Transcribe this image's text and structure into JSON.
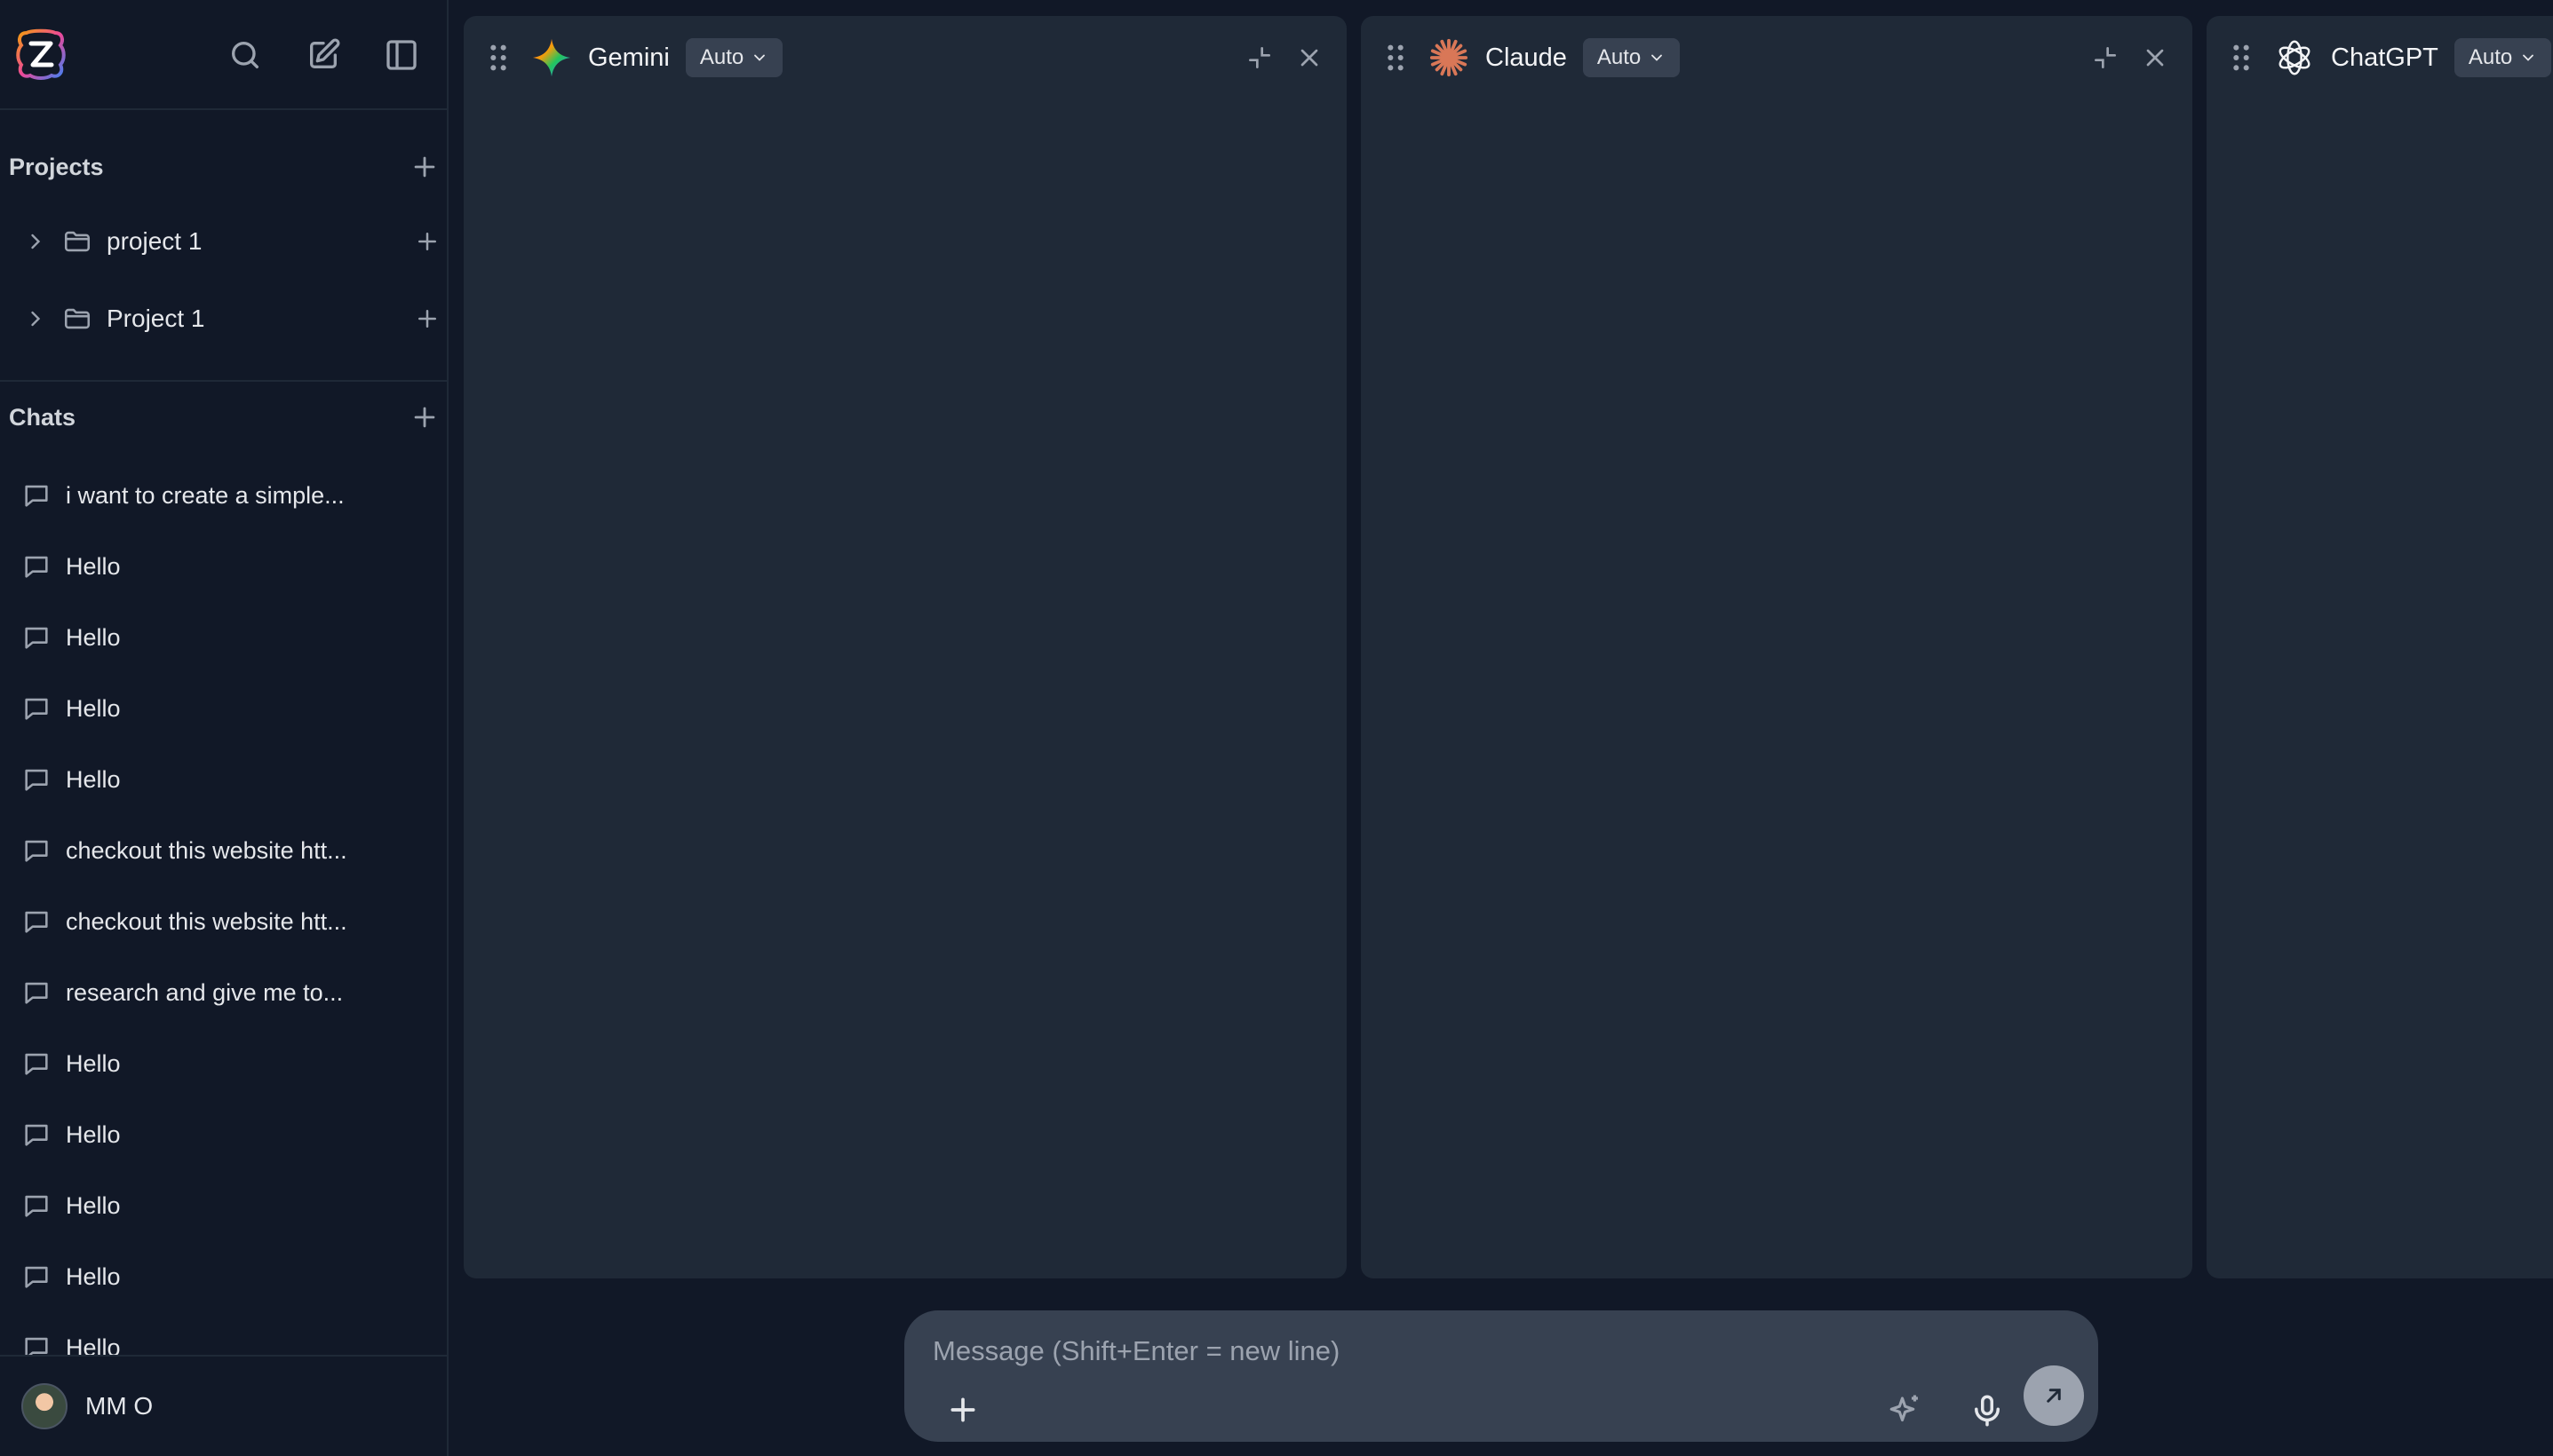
{
  "sidebar": {
    "projects_title": "Projects",
    "projects": [
      {
        "label": "project 1"
      },
      {
        "label": "Project 1"
      }
    ],
    "chats_title": "Chats",
    "chats": [
      {
        "label": "i want to create a simple..."
      },
      {
        "label": "Hello"
      },
      {
        "label": "Hello"
      },
      {
        "label": "Hello"
      },
      {
        "label": "Hello"
      },
      {
        "label": "checkout this website htt..."
      },
      {
        "label": "checkout this website htt..."
      },
      {
        "label": "research and give me to..."
      },
      {
        "label": "Hello"
      },
      {
        "label": "Hello"
      },
      {
        "label": "Hello"
      },
      {
        "label": "Hello"
      },
      {
        "label": "Hello"
      }
    ],
    "user": {
      "name": "MM O"
    }
  },
  "panels": [
    {
      "name": "Gemini",
      "mode": "Auto",
      "icon": "gemini-logo"
    },
    {
      "name": "Claude",
      "mode": "Auto",
      "icon": "claude-logo"
    },
    {
      "name": "ChatGPT",
      "mode": "Auto",
      "icon": "chatgpt-logo"
    }
  ],
  "composer": {
    "placeholder": "Message (Shift+Enter = new line)"
  },
  "colors": {
    "background": "#111827",
    "panel": "#1f2937",
    "pill": "#374151",
    "claude_accent": "#d97757"
  }
}
